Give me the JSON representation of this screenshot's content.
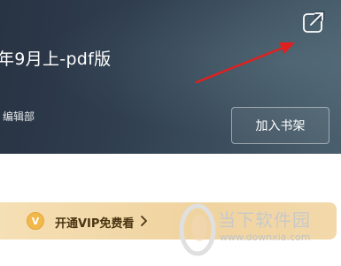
{
  "book": {
    "title": "年9月上-pdf版",
    "publisher": "编辑部",
    "add_to_shelf_label": "加入书架"
  },
  "icons": {
    "share": "share-external-icon",
    "annotation_arrow": "red-arrow-annotation"
  },
  "vip": {
    "badge": "V",
    "label": "开通VIP免费看"
  },
  "watermark": {
    "name": "当下软件园",
    "url": "www.downxia.com"
  },
  "colors": {
    "header_bg": "#2f3d4e",
    "vip_bar": "#f0d39f",
    "vip_coin": "#f2b84b",
    "arrow": "#e02020"
  }
}
